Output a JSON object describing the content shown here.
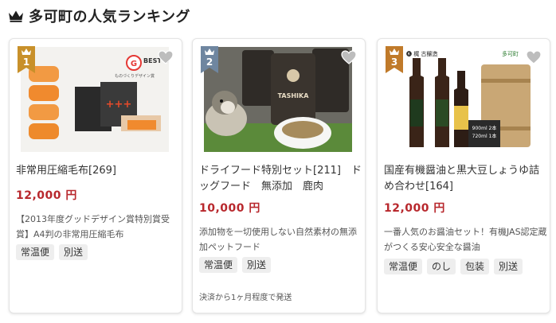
{
  "header": {
    "title": "多可町の人気ランキング",
    "icon": "crown-icon"
  },
  "colors": {
    "price": "#b8282d",
    "rank_gold": "#c8902a",
    "rank_silver": "#6f86a0",
    "rank_bronze": "#c07a2a"
  },
  "cards": [
    {
      "rank": "1",
      "name": "非常用圧縮毛布[269]",
      "price": "12,000 円",
      "desc": "【2013年度グッドデザイン賞特別賞受賞】A4判の非常用圧縮毛布",
      "tags": [
        "常温便",
        "別送"
      ],
      "image_text": {
        "badge": "BEST 100",
        "badge_sub": "ものづくりデザイン賞",
        "box_mark": "+++"
      }
    },
    {
      "rank": "2",
      "name": "ドライフード特別セット[211]　ドッグフード　無添加　鹿肉",
      "price": "10,000 円",
      "desc": "添加物を一切使用しない自然素材の無添加ペットフード",
      "tags": [
        "常温便",
        "別送"
      ],
      "note": "決済から1ヶ月程度で発送",
      "image_text": {
        "bag_label": "TASHIKA"
      }
    },
    {
      "rank": "3",
      "name": "国産有機醤油と黒大豆しょうゆ詰め合わせ[164]",
      "price": "12,000 円",
      "desc": "一番人気のお醤油セット！有機JAS認定蔵がつくる安心安全な醤油",
      "tags": [
        "常温便",
        "のし",
        "包装",
        "別送"
      ],
      "image_text": {
        "brand": "🅚 梶 古醸造",
        "town": "多可町",
        "size1": "900ml 2本",
        "size2": "720ml 1本"
      }
    }
  ]
}
